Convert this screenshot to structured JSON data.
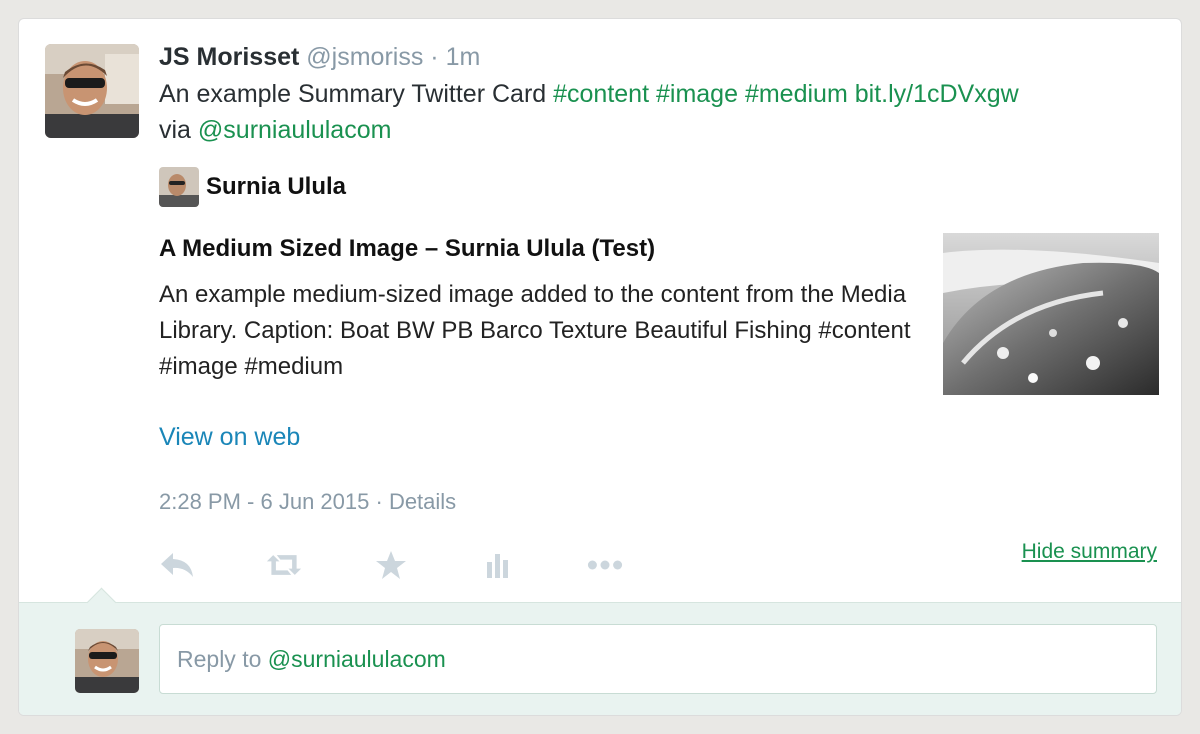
{
  "tweet": {
    "name": "JS Morisset",
    "handle": "@jsmoriss",
    "separator": "·",
    "time": "1m",
    "text_plain": "An example Summary Twitter Card",
    "hashtags": [
      "#content",
      "#image",
      "#medium"
    ],
    "link": "bit.ly/1cDVxgw",
    "via_label": "via",
    "via_mention": "@surniaululacom"
  },
  "card": {
    "author_name": "Surnia Ulula",
    "title": "A Medium Sized Image – Surnia Ulula (Test)",
    "description": "An example medium-sized image added to the content from the Media Library. Caption: Boat BW PB Barco Texture Beautiful Fishing #content #image #medium",
    "view_on_web": "View on web"
  },
  "meta": {
    "timestamp": "2:28 PM - 6 Jun 2015",
    "separator": "·",
    "details": "Details"
  },
  "actions": {
    "icons": [
      "reply-icon",
      "retweet-icon",
      "favorite-icon",
      "analytics-icon",
      "more-icon"
    ],
    "hide_summary": "Hide summary"
  },
  "reply": {
    "prefix": "Reply to",
    "mention": "@surniaululacom"
  },
  "colors": {
    "hashtag_green": "#1a9150",
    "link_blue": "#1a86b8",
    "muted_gray": "#8899a6",
    "action_icon": "#ccd6dd",
    "reply_bg": "#e9f3f0"
  }
}
